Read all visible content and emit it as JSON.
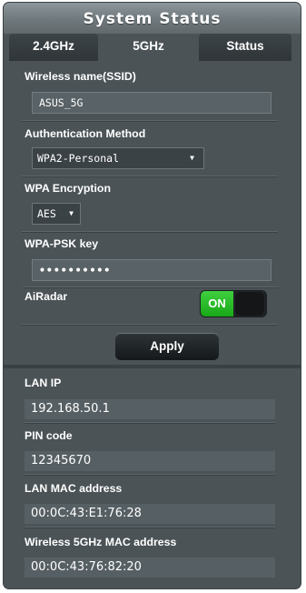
{
  "title": "System Status",
  "tabs": [
    {
      "label": "2.4GHz",
      "active": false
    },
    {
      "label": "5GHz",
      "active": true
    },
    {
      "label": "Status",
      "active": false
    }
  ],
  "wireless": {
    "ssid_label": "Wireless name(SSID)",
    "ssid_value": "ASUS_5G",
    "auth_label": "Authentication Method",
    "auth_value": "WPA2-Personal",
    "enc_label": "WPA Encryption",
    "enc_value": "AES",
    "psk_label": "WPA-PSK key",
    "psk_value": "••••••••••",
    "airadar_label": "AiRadar",
    "airadar_state": "ON",
    "apply_label": "Apply"
  },
  "status": {
    "lan_ip_label": "LAN IP",
    "lan_ip_value": "192.168.50.1",
    "pin_label": "PIN code",
    "pin_value": "12345670",
    "lan_mac_label": "LAN MAC address",
    "lan_mac_value": "00:0C:43:E1:76:28",
    "wl_mac_label": "Wireless 5GHz MAC address",
    "wl_mac_value": "00:0C:43:76:82:20"
  },
  "colors": {
    "panel": "#4b5357",
    "accent_on": "#22b822",
    "title_bar": "#7a8387"
  }
}
